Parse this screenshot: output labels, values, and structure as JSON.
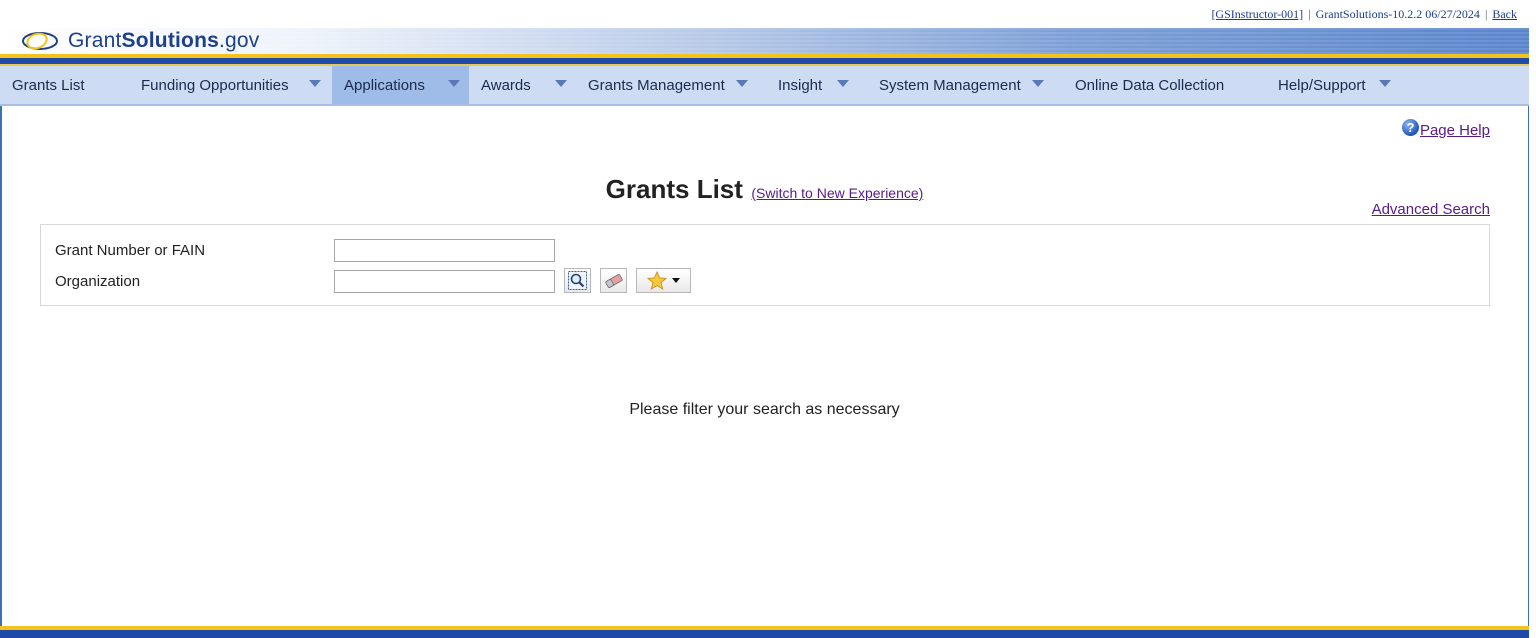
{
  "topbar": {
    "user": "[GSInstructor-001]",
    "version": "GrantSolutions-10.2.2",
    "date": "06/27/2024",
    "back": "Back"
  },
  "brand": {
    "name_light": "Grant",
    "name_bold": "Solutions",
    "suffix": ".gov"
  },
  "nav": {
    "items": [
      {
        "label": "Grants List"
      },
      {
        "label": "Funding Opportunities"
      },
      {
        "label": "Applications"
      },
      {
        "label": "Awards"
      },
      {
        "label": "Grants Management"
      },
      {
        "label": "Insight"
      },
      {
        "label": "System Management"
      },
      {
        "label": "Online Data Collection"
      },
      {
        "label": "Help/Support"
      }
    ]
  },
  "page": {
    "help": "Page Help",
    "title": "Grants List",
    "switch": "(Switch to New Experience)",
    "advanced_search": "Advanced Search",
    "empty_message": "Please filter your search as necessary"
  },
  "search": {
    "grant_label": "Grant Number or FAIN",
    "grant_value": "",
    "org_label": "Organization",
    "org_value": ""
  },
  "colors": {
    "brand_blue": "#1f4aa8",
    "brand_gold": "#f3c31b",
    "nav_bg": "#cddcf3",
    "nav_active": "#9fbbe8",
    "link_visited": "#551a8b"
  }
}
